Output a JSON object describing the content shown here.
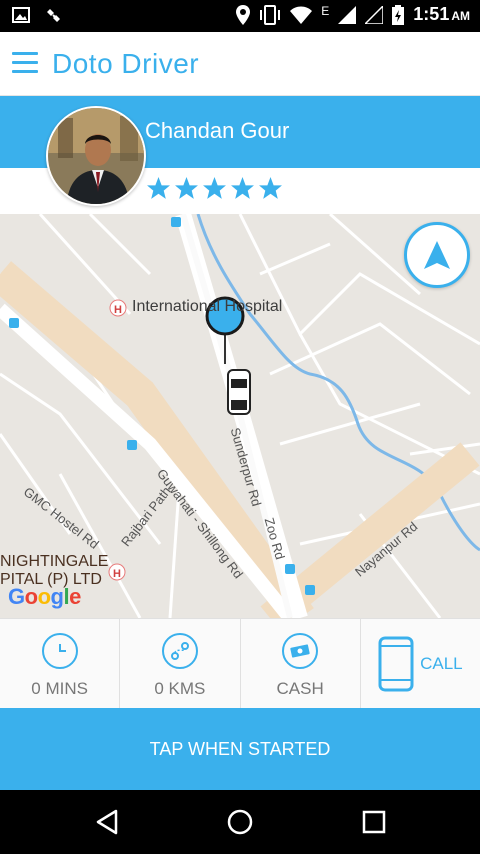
{
  "status_bar": {
    "time": "1:51",
    "ampm": "AM",
    "net": "E"
  },
  "app": {
    "title": "Doto Driver"
  },
  "driver": {
    "name": "Chandan Gour",
    "rating": 5
  },
  "map": {
    "labels": {
      "hospital": "International Hospital",
      "gmc": "GMC Hostel Rd",
      "rajbari": "Rajbari Path",
      "guwahati": "Guwahati - Shillong Rd",
      "sunderpur": "Sunderpur Rd",
      "zoo": "Zoo Rd",
      "nayanpur": "Nayanpur Rd",
      "nightingale": "NIGHTINGALE",
      "pital": "PITAL (P) LTD"
    },
    "google": "Google"
  },
  "trip": {
    "time": "0 MINS",
    "distance": "0 KMS",
    "payment": "CASH",
    "call_label": "CALL"
  },
  "actions": {
    "start_label": "TAP WHEN STARTED"
  },
  "colors": {
    "accent": "#3ab0ec"
  }
}
